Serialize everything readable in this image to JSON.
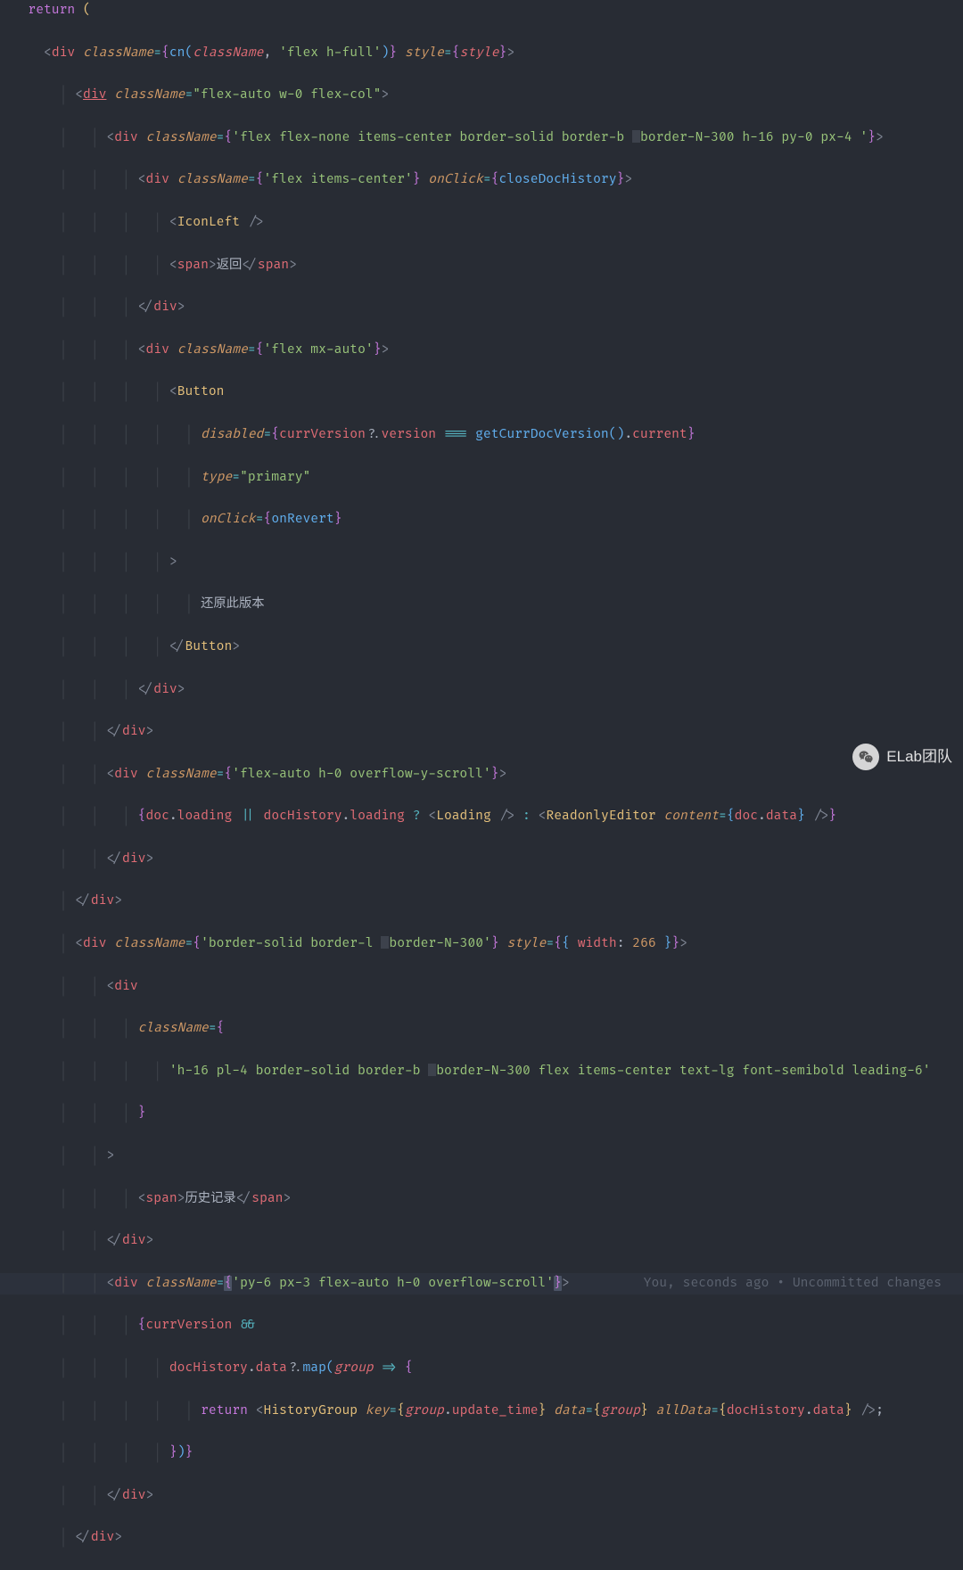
{
  "code": {
    "returnKw": "return",
    "div": "div",
    "span": "span",
    "Button": "Button",
    "IconLeft": "IconLeft",
    "Loading": "Loading",
    "ReadonlyEditor": "ReadonlyEditor",
    "HistoryGroup": "HistoryGroup",
    "classNameAttr": "className",
    "styleAttr": "style",
    "onClickAttr": "onClick",
    "disabledAttr": "disabled",
    "typeAttr": "type",
    "keyAttr": "key",
    "dataAttr": "data",
    "allDataAttr": "allData",
    "contentAttr": "content",
    "cn": "cn",
    "classNameVar": "className",
    "styleVar": "style",
    "str_flex_h_full": "'flex h-full'",
    "str_flex_auto_w0": "\"flex-auto w-0 flex-col\"",
    "str_header": "'flex flex-none items-center border-solid border-b ",
    "str_header2": "border-N-300 h-16 py-0 px-4 '",
    "str_flex_items_center": "'flex items-center'",
    "closeDocHistory": "closeDocHistory",
    "text_back": "返回",
    "str_flex_mx_auto": "'flex mx-auto'",
    "currVersion": "currVersion",
    "version": "version",
    "getCurrDocVersion": "getCurrDocVersion",
    "current": "current",
    "str_primary": "\"primary\"",
    "onRevert": "onRevert",
    "text_restore": "还原此版本",
    "str_flex_auto_h0": "'flex-auto h-0 overflow-y-scroll'",
    "doc": "doc",
    "loading": "loading",
    "docHistory": "docHistory",
    "dataProp": "data",
    "str_border_l": "'border-solid border-l ",
    "str_border_l2": "border-N-300'",
    "width": "width",
    "num266": "266",
    "str_h16": "'h-16 pl-4 border-solid border-b ",
    "str_h16_2": "border-N-300 flex items-center text-lg font-semibold leading-6'",
    "text_history": "历史记录",
    "str_py6": "'py-6 px-3 flex-auto h-0 overflow-scroll'",
    "map": "map",
    "group": "group",
    "update_time": "update_time"
  },
  "gitLens": "You, seconds ago • Uncommitted changes",
  "watermark": "ELab团队"
}
